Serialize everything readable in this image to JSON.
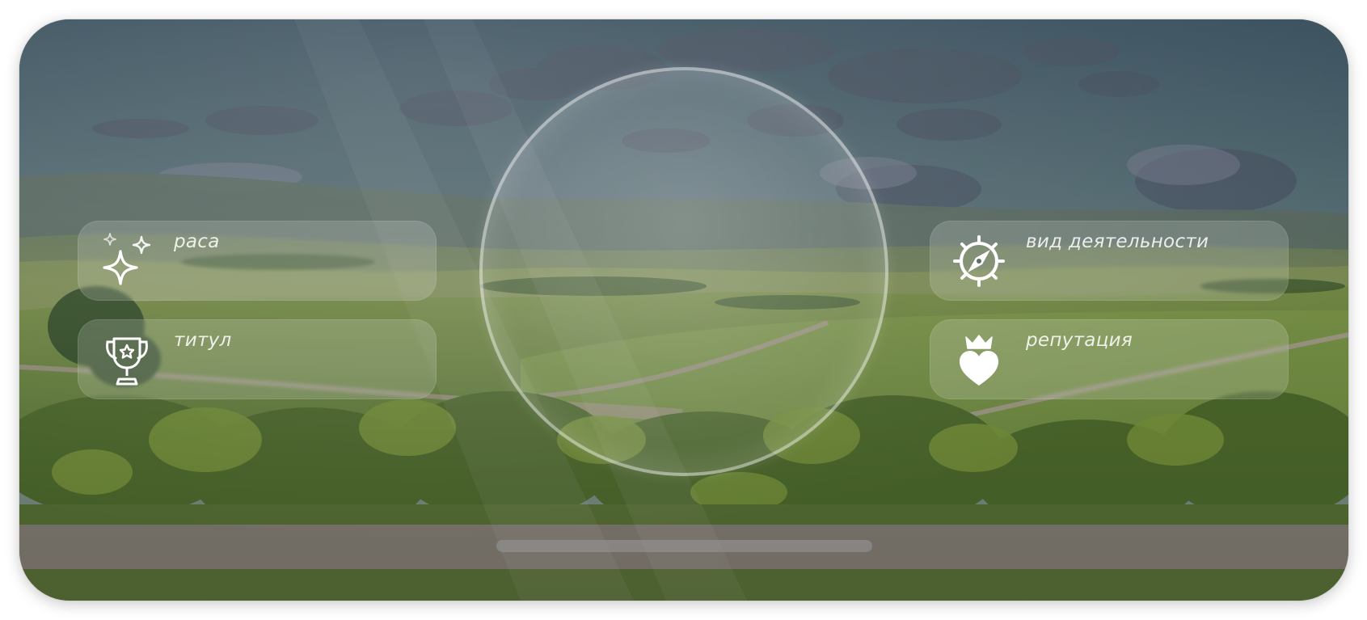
{
  "cards": {
    "race": {
      "label": "раса",
      "icon": "sparkles-icon"
    },
    "title": {
      "label": "титул",
      "icon": "trophy-icon"
    },
    "occupation": {
      "label": "вид деятельности",
      "icon": "compass-icon"
    },
    "reputation": {
      "label": "репутация",
      "icon": "crowned-heart-icon"
    }
  },
  "colors": {
    "card_background": "rgba(255,255,255,0.16)",
    "label_text": "#ffffff",
    "lens_ring": "#ffffff",
    "home_indicator": "#969696"
  }
}
